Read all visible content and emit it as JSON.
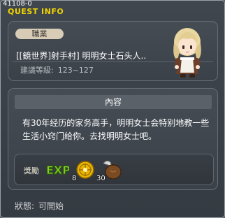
{
  "window": {
    "quest_id": "41108-0",
    "title": "QUEST INFO"
  },
  "quest": {
    "job_tag": "職業",
    "name": "[[鏡世界]射手村] 明明女士石头人..",
    "level_label": "建議等級:",
    "level_range": "123~127"
  },
  "content": {
    "header": "內容",
    "description": "有30年经历的家务高手，明明女士会特别地教一些生活小窍门给你。去找明明女士吧。"
  },
  "reward": {
    "label": "獎勵",
    "exp_text": "EXP",
    "items": [
      {
        "icon": "gold-coin-icon",
        "count": "8"
      },
      {
        "icon": "pouch-icon",
        "count": "30"
      }
    ]
  },
  "status": {
    "label": "狀態:",
    "value": "可開始"
  },
  "colors": {
    "title": "#f2d300",
    "exp_green": "#7ed321",
    "tag_bg": "#d8ccb6"
  }
}
